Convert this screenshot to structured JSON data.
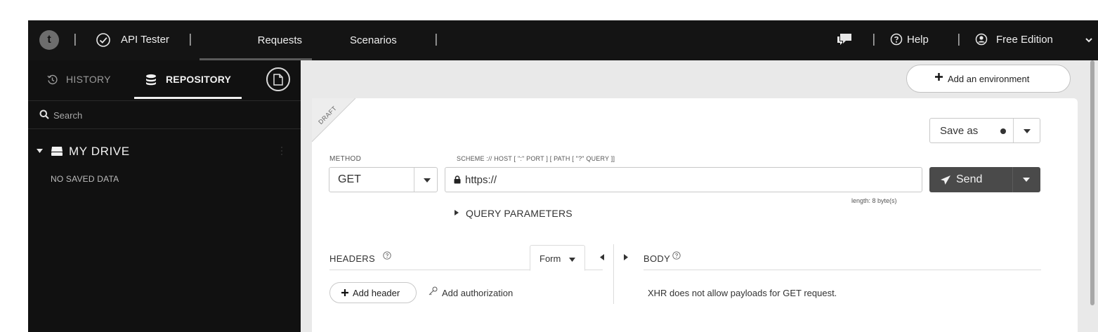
{
  "topbar": {
    "logo_letter": "t",
    "separator": "|",
    "app_name": "API Tester",
    "tabs": [
      {
        "label": "Requests",
        "active": true
      },
      {
        "label": "Scenarios",
        "active": false
      }
    ],
    "help_label": "Help",
    "edition_label": "Free Edition",
    "icons": [
      "chat-icon",
      "help-icon",
      "user-icon",
      "chevron-down-icon",
      "check-circle-icon"
    ]
  },
  "sidebar": {
    "tabs": [
      {
        "label": "HISTORY",
        "icon": "history-icon",
        "active": false
      },
      {
        "label": "REPOSITORY",
        "icon": "database-icon",
        "active": true
      }
    ],
    "search": {
      "placeholder": "Search",
      "value": ""
    },
    "drive": {
      "label": "MY DRIVE",
      "icon": "drive-icon"
    },
    "empty_text": "NO SAVED DATA"
  },
  "main": {
    "add_environment_label": "Add an environment",
    "request": {
      "draft_label": "DRAFT",
      "save_as_label": "Save as",
      "method_label": "METHOD",
      "method_value": "GET",
      "scheme_label": "SCHEME :// HOST [ \":\" PORT ] [ PATH [ \"?\" QUERY ]]",
      "url_value": "https://",
      "length_text": "length: 8 byte(s)",
      "send_label": "Send",
      "query_params_label": "QUERY PARAMETERS",
      "headers_title": "HEADERS",
      "form_label": "Form",
      "add_header_label": "Add header",
      "add_authorization_label": "Add authorization",
      "body_title": "BODY",
      "body_message": "XHR does not allow payloads for GET request."
    }
  },
  "colors": {
    "topbar_bg": "#141414",
    "sidebar_bg": "#111111",
    "main_bg": "#e9e9e9",
    "send_button": "#4a4a4a"
  }
}
